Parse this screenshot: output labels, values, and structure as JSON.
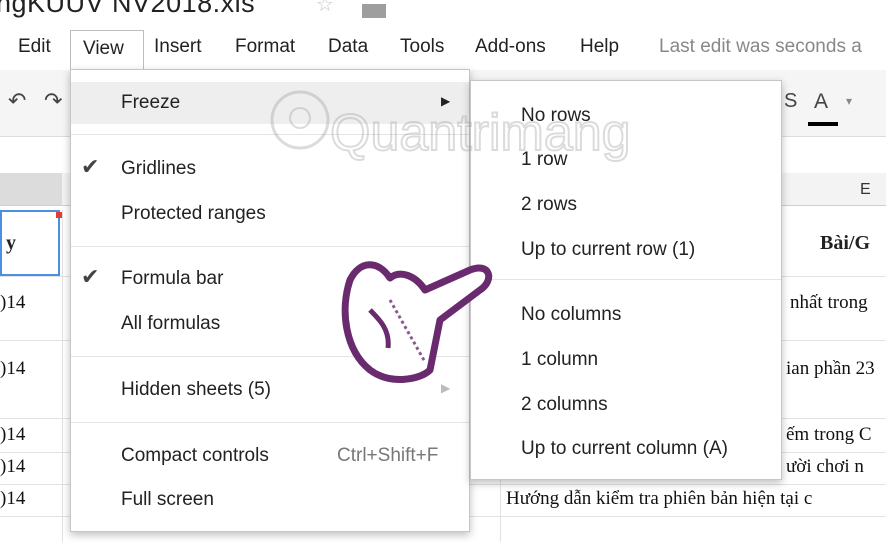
{
  "document": {
    "title_partial": "ngKUUV NV2018.xls"
  },
  "menubar": {
    "items": [
      "Edit",
      "View",
      "Insert",
      "Format",
      "Data",
      "Tools",
      "Add-ons",
      "Help"
    ],
    "last_edit": "Last edit was seconds a"
  },
  "toolbar": {
    "undo_icon": "undo-icon",
    "redo_icon": "redo-icon",
    "strikethrough_icon": "strikethrough-icon",
    "font_color_label": "A",
    "font_color_underline": "#000000"
  },
  "sheet": {
    "column_e_label": "E",
    "header_left": "y",
    "header_right": "Bài/G",
    "rows": [
      {
        "date": ")14",
        "text": "nhất trong"
      },
      {
        "date": ")14",
        "text": "ian phần 23"
      },
      {
        "date": ")14",
        "text": "ếm trong C"
      },
      {
        "date": ")14",
        "text": "ười chơi n"
      },
      {
        "date": ")14",
        "text": "Hướng dẫn kiểm tra phiên bản hiện tại c"
      }
    ]
  },
  "view_menu": {
    "items": {
      "freeze": "Freeze",
      "gridlines": "Gridlines",
      "protected_ranges": "Protected ranges",
      "formula_bar": "Formula bar",
      "all_formulas": "All formulas",
      "hidden_sheets": "Hidden sheets (5)",
      "compact_controls": "Compact controls",
      "compact_shortcut": "Ctrl+Shift+F",
      "full_screen": "Full screen"
    },
    "checked": [
      "Gridlines",
      "Formula bar"
    ]
  },
  "freeze_submenu": {
    "items": [
      "No rows",
      "1 row",
      "2 rows",
      "Up to current row (1)",
      "No columns",
      "1 column",
      "2 columns",
      "Up to current column (A)"
    ]
  },
  "watermark": {
    "text": "Quantrimang"
  },
  "colors": {
    "selection_border": "#4a90e2",
    "menu_highlight": "#eeeeee",
    "hand_outline": "#6a2a6e"
  }
}
